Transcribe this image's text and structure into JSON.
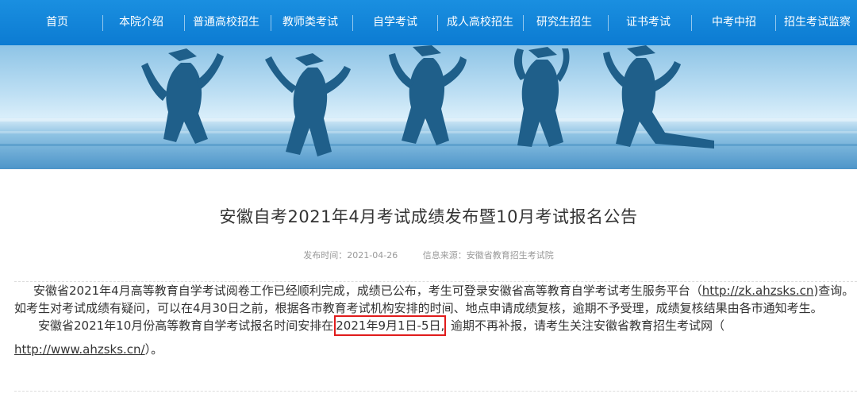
{
  "nav": {
    "items": [
      {
        "label": "首页"
      },
      {
        "label": "本院介绍"
      },
      {
        "label": "普通高校招生"
      },
      {
        "label": "教师类考试"
      },
      {
        "label": "自学考试"
      },
      {
        "label": "成人高校招生"
      },
      {
        "label": "研究生招生"
      },
      {
        "label": "证书考试"
      },
      {
        "label": "中考中招"
      },
      {
        "label": "招生考试监察"
      }
    ]
  },
  "banner": {
    "icon": "graduates-jumping-banner"
  },
  "article": {
    "title": "安徽自考2021年4月考试成绩发布暨10月考试报名公告",
    "publish_time": "发布时间：2021-04-26",
    "source": "信息来源：安徽省教育招生考试院",
    "p1_text_a": "安徽省2021年4月高等教育自学考试阅卷工作已经顺利完成，成绩已公布，考生可登录安徽省高等教育自学考试考生服务平台（",
    "p1_link": "http://zk.ahzsks.cn",
    "p1_text_b": ")查询。如考生对考试成绩有疑问，可以在4月30日之前，根据各市教育考试机构安排的时间、地点申请成绩复核，逾期不予受理，成绩复核结果由各市通知考生。",
    "p2_text_a": "安徽省2021年10月份高等教育自学考试报名时间安排在",
    "p2_highlight": "2021年9月1日-5日,",
    "p2_text_b": " 逾期不再补报，请考生关注安徽省教育招生考试网（",
    "p2_link": "http://www.ahzsks.cn/",
    "p2_text_c": "）。"
  },
  "colors": {
    "nav": "#0c7bd2",
    "highlight_border": "#e01b1b"
  }
}
